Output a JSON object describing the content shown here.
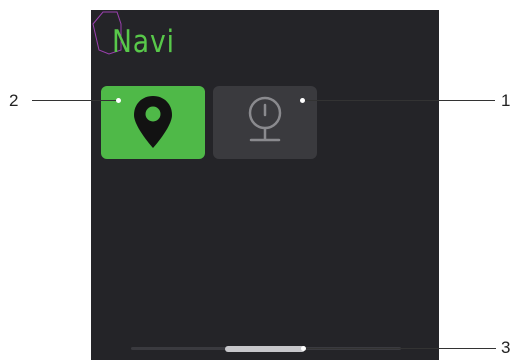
{
  "screen": {
    "title": "Navi",
    "tiles": [
      {
        "icon": "location-pin-icon",
        "state": "selected"
      },
      {
        "icon": "compass-globe-icon",
        "state": "unselected"
      }
    ],
    "scroll": {
      "thumb_position": 0.5
    }
  },
  "callouts": [
    {
      "number": "1",
      "target": "compass-tile"
    },
    {
      "number": "2",
      "target": "navigation-tile"
    },
    {
      "number": "3",
      "target": "scrollbar-thumb"
    }
  ],
  "colors": {
    "screen_bg": "#242428",
    "accent_green": "#4fb948",
    "title_green": "#58c84a",
    "inactive_tile": "#3a3a3e"
  }
}
